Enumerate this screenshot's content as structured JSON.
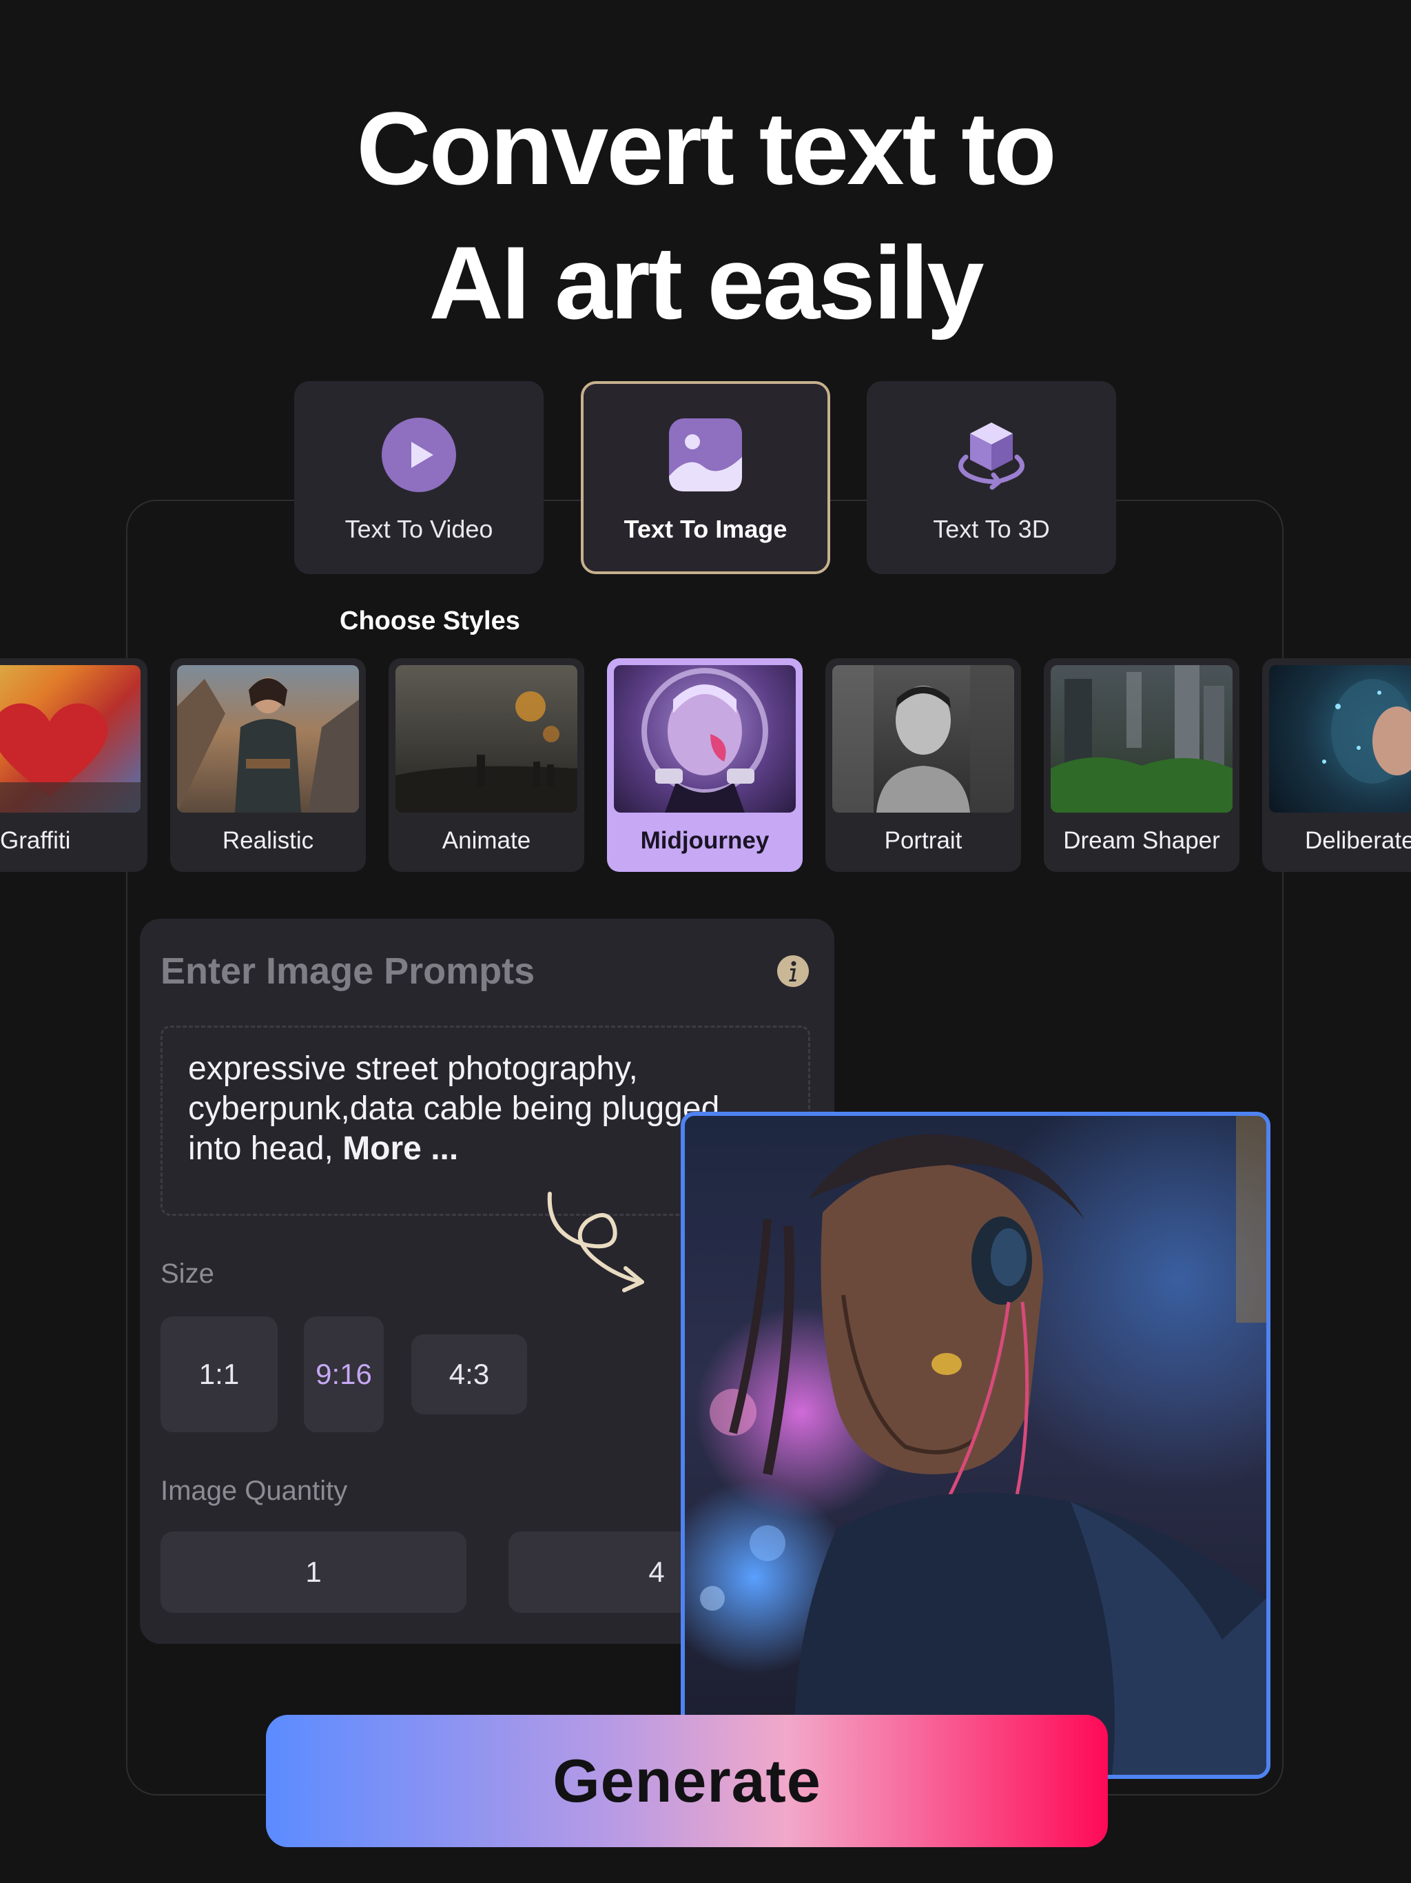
{
  "headline": {
    "line1": "Convert text to",
    "line2": "AI art easily"
  },
  "modes": [
    {
      "label": "Text To Video",
      "icon": "play-circle-icon",
      "active": false
    },
    {
      "label": "Text To Image",
      "icon": "image-icon",
      "active": true
    },
    {
      "label": "Text To 3D",
      "icon": "cube-rotate-icon",
      "active": false
    }
  ],
  "styles_label": "Choose Styles",
  "styles": [
    {
      "label": "Graffiti",
      "active": false
    },
    {
      "label": "Realistic",
      "active": false
    },
    {
      "label": "Animate",
      "active": false
    },
    {
      "label": "Midjourney",
      "active": true
    },
    {
      "label": "Portrait",
      "active": false
    },
    {
      "label": "Dream Shaper",
      "active": false
    },
    {
      "label": "Deliberate",
      "active": false
    }
  ],
  "prompt": {
    "title": "Enter Image Prompts",
    "text": "expressive street photography, cyberpunk,data cable being plugged into head, ",
    "more": "More ..."
  },
  "size": {
    "label": "Size",
    "options": [
      "1:1",
      "9:16",
      "4:3"
    ],
    "selected": "9:16"
  },
  "quantity": {
    "label": "Image Quantity",
    "options": [
      "1",
      "4"
    ]
  },
  "generate_label": "Generate",
  "colors": {
    "background": "#141415",
    "accent_purple": "#c6a8f5",
    "active_border": "#c7b18e",
    "result_border": "#4f83f2",
    "gradient_start": "#5b8cff",
    "gradient_mid": "#f2a8c9",
    "gradient_end": "#ff0a57"
  }
}
